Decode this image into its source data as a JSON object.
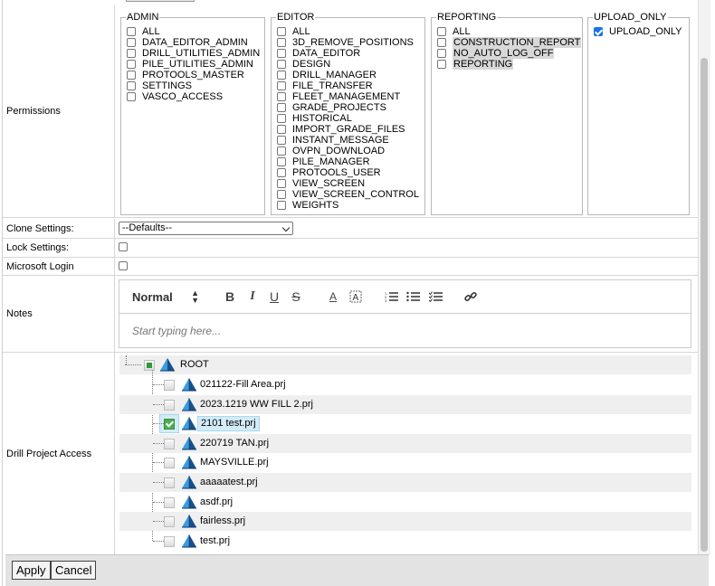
{
  "labels": {
    "permissions": "Permissions",
    "clone_settings": "Clone Settings:",
    "lock_settings": "Lock Settings:",
    "microsoft_login": "Microsoft Login",
    "notes": "Notes",
    "drill_project_access": "Drill Project Access"
  },
  "permissions": {
    "admin": {
      "legend": "ADMIN",
      "items": [
        {
          "label": "ALL",
          "checked": false
        },
        {
          "label": "DATA_EDITOR_ADMIN",
          "checked": false
        },
        {
          "label": "DRILL_UTILITIES_ADMIN",
          "checked": false
        },
        {
          "label": "PILE_UTILITIES_ADMIN",
          "checked": false
        },
        {
          "label": "PROTOOLS_MASTER",
          "checked": false
        },
        {
          "label": "SETTINGS",
          "checked": false
        },
        {
          "label": "VASCO_ACCESS",
          "checked": false
        }
      ]
    },
    "editor": {
      "legend": "EDITOR",
      "items": [
        {
          "label": "ALL",
          "checked": false
        },
        {
          "label": "3D_REMOVE_POSITIONS",
          "checked": false
        },
        {
          "label": "DATA_EDITOR",
          "checked": false
        },
        {
          "label": "DESIGN",
          "checked": false
        },
        {
          "label": "DRILL_MANAGER",
          "checked": false
        },
        {
          "label": "FILE_TRANSFER",
          "checked": false
        },
        {
          "label": "FLEET_MANAGEMENT",
          "checked": false
        },
        {
          "label": "GRADE_PROJECTS",
          "checked": false
        },
        {
          "label": "HISTORICAL",
          "checked": false
        },
        {
          "label": "IMPORT_GRADE_FILES",
          "checked": false
        },
        {
          "label": "INSTANT_MESSAGE",
          "checked": false
        },
        {
          "label": "OVPN_DOWNLOAD",
          "checked": false
        },
        {
          "label": "PILE_MANAGER",
          "checked": false
        },
        {
          "label": "PROTOOLS_USER",
          "checked": false
        },
        {
          "label": "VIEW_SCREEN",
          "checked": false
        },
        {
          "label": "VIEW_SCREEN_CONTROL",
          "checked": false
        },
        {
          "label": "WEIGHTS",
          "checked": false
        }
      ]
    },
    "reporting": {
      "legend": "REPORTING",
      "items": [
        {
          "label": "ALL",
          "checked": false,
          "highlight": false
        },
        {
          "label": "CONSTRUCTION_REPORT",
          "checked": false,
          "highlight": true
        },
        {
          "label": "NO_AUTO_LOG_OFF",
          "checked": false,
          "highlight": true
        },
        {
          "label": "REPORTING",
          "checked": false,
          "highlight": true
        }
      ]
    },
    "upload_only": {
      "legend": "UPLOAD_ONLY",
      "items": [
        {
          "label": "UPLOAD_ONLY",
          "checked": true
        }
      ]
    }
  },
  "clone_settings": {
    "selected": "--Defaults--"
  },
  "notes": {
    "format_select": "Normal",
    "placeholder": "Start typing here...",
    "toolbar": {
      "bold": "B",
      "italic": "I",
      "underline": "U",
      "strike": "S",
      "color": "A"
    }
  },
  "tree": {
    "root": "ROOT",
    "items": [
      {
        "label": "021122-Fill Area.prj",
        "checked": false,
        "selected": false
      },
      {
        "label": "2023.1219 WW FILL 2.prj",
        "checked": false,
        "selected": false
      },
      {
        "label": "2101 test.prj",
        "checked": true,
        "selected": true
      },
      {
        "label": "220719 TAN.prj",
        "checked": false,
        "selected": false
      },
      {
        "label": "MAYSVILLE.prj",
        "checked": false,
        "selected": false
      },
      {
        "label": "aaaaatest.prj",
        "checked": false,
        "selected": false
      },
      {
        "label": "asdf.prj",
        "checked": false,
        "selected": false
      },
      {
        "label": "fairless.prj",
        "checked": false,
        "selected": false
      },
      {
        "label": "test.prj",
        "checked": false,
        "selected": false
      }
    ]
  },
  "buttons": {
    "apply": "Apply",
    "cancel": "Cancel"
  },
  "colors": {
    "checkbox_accent": "#1a73e8",
    "tree_check": "#4caf50",
    "tree_selection": "#d4ecf8",
    "footer_bg": "#e3e3e3"
  },
  "icons": {
    "project": "pyramid-icon",
    "root": "pyramid-icon"
  }
}
